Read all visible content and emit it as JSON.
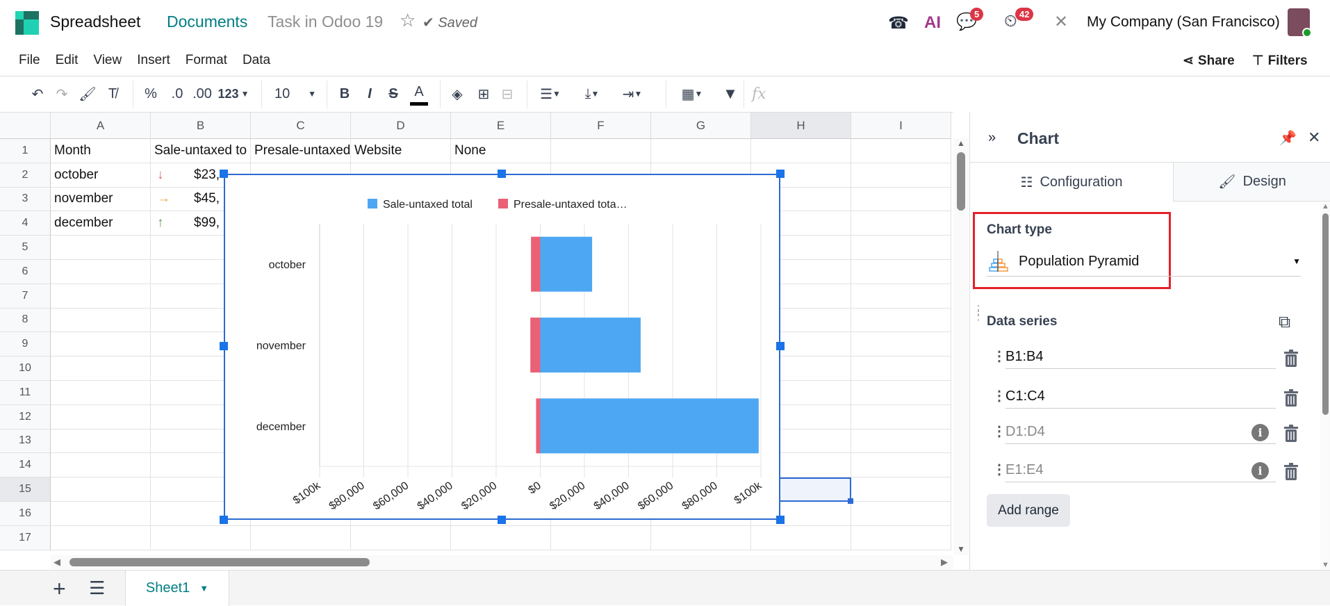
{
  "app": {
    "name": "Spreadsheet",
    "breadcrumb": "Documents",
    "doc_title": "Task in Odoo 19",
    "save_state": "Saved"
  },
  "systray": {
    "chat_badge": "5",
    "activity_badge": "42",
    "company": "My Company (San Francisco)",
    "ai_label": "AI"
  },
  "menu": [
    "File",
    "Edit",
    "View",
    "Insert",
    "Format",
    "Data"
  ],
  "actions": {
    "share": "Share",
    "filters": "Filters"
  },
  "toolbar": {
    "percent": "%",
    "dec_less": ".0",
    "dec_more": ".00",
    "format": "123",
    "font_size": "10",
    "bold": "B",
    "italic": "I",
    "strike": "S",
    "text_color": "A",
    "fx": "fx"
  },
  "sheet": {
    "columns": [
      "A",
      "B",
      "C",
      "D",
      "E",
      "F",
      "G",
      "H",
      "I"
    ],
    "rows": [
      "1",
      "2",
      "3",
      "4",
      "5",
      "6",
      "7",
      "8",
      "9",
      "10",
      "11",
      "12",
      "13",
      "14",
      "15",
      "16",
      "17"
    ],
    "cells": [
      [
        "Month",
        "Sale-untaxed to",
        "Presale-untaxed",
        "Website",
        "None"
      ],
      [
        "october",
        "$23,",
        "",
        "",
        ""
      ],
      [
        "november",
        "$45,",
        "",
        "",
        ""
      ],
      [
        "december",
        "$99,",
        "",
        "",
        ""
      ]
    ],
    "trend_icons": [
      "arrow-down",
      "arrow-right",
      "arrow-up"
    ],
    "trend_colors": [
      "#e06666",
      "#f1a33a",
      "#5aa04a"
    ],
    "active_tab": "Sheet1"
  },
  "chart_data": {
    "type": "bar",
    "subtype": "population-pyramid",
    "categories": [
      "october",
      "november",
      "december"
    ],
    "series": [
      {
        "name": "Sale-untaxed total",
        "legend_label": "Sale-untaxed total",
        "color": "#4ea7f2",
        "values": [
          23500,
          45500,
          99000
        ]
      },
      {
        "name": "Presale-untaxed total",
        "legend_label": "Presale-untaxed tota…",
        "color": "#ea6175",
        "values": [
          -4200,
          -4500,
          -1900
        ]
      }
    ],
    "xlim": [
      -100000,
      100000
    ],
    "xticks": [
      "$100k",
      "$80,000",
      "$60,000",
      "$40,000",
      "$20,000",
      "$0",
      "$20,000",
      "$40,000",
      "$60,000",
      "$80,000",
      "$100k"
    ],
    "legend": "top",
    "grid": true
  },
  "panel": {
    "title": "Chart",
    "tabs": [
      "Configuration",
      "Design"
    ],
    "chart_type_label": "Chart type",
    "chart_type_value": "Population Pyramid",
    "data_series_label": "Data series",
    "ranges": [
      "B1:B4",
      "C1:C4",
      "D1:D4",
      "E1:E4"
    ],
    "add_range": "Add range",
    "highlight_color": "#e5202a"
  }
}
